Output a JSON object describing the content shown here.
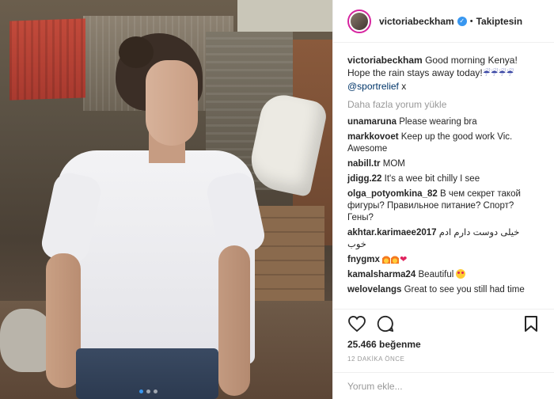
{
  "header": {
    "username": "victoriabeckham",
    "separator": "•",
    "follow_label": "Takiptesin"
  },
  "caption": {
    "username": "victoriabeckham",
    "text": "Good morning Kenya! Hope the rain stays away today!",
    "emoji": "☔☔☔☔",
    "mention": "@sportrelief",
    "suffix": " x"
  },
  "load_more": "Daha fazla yorum yükle",
  "comments": [
    {
      "user": "unamaruna",
      "text": "Please wearing bra"
    },
    {
      "user": "markkovoet",
      "text": "Keep up the good work Vic. Awesome"
    },
    {
      "user": "nabill.tr",
      "text": "MOM"
    },
    {
      "user": "jdigg.22",
      "text": "It's a wee bit chilly I see"
    },
    {
      "user": "olga_potyomkina_82",
      "text": "В чем секрет такой фигуры? Правильное питание? Спорт? Гены?"
    },
    {
      "user": "akhtar.karimaee2017",
      "text": "خیلی دوست دارم ادم خوب"
    },
    {
      "user": "fnygmx",
      "text": ""
    },
    {
      "user": "kamalsharma24",
      "text": "Beautiful"
    },
    {
      "user": "welovelangs",
      "text": "Great to see you still had time"
    }
  ],
  "likes": "25.466 beğenme",
  "timestamp": "12 DAKİKA ÖNCE",
  "add_comment_placeholder": "Yorum ekle...",
  "icons": {
    "like": "heart-icon",
    "comment": "comment-icon",
    "save": "bookmark-icon",
    "verified": "verified-badge-icon"
  },
  "colors": {
    "accent": "#3897f0",
    "text": "#262626",
    "muted": "#999999",
    "link": "#003569"
  }
}
